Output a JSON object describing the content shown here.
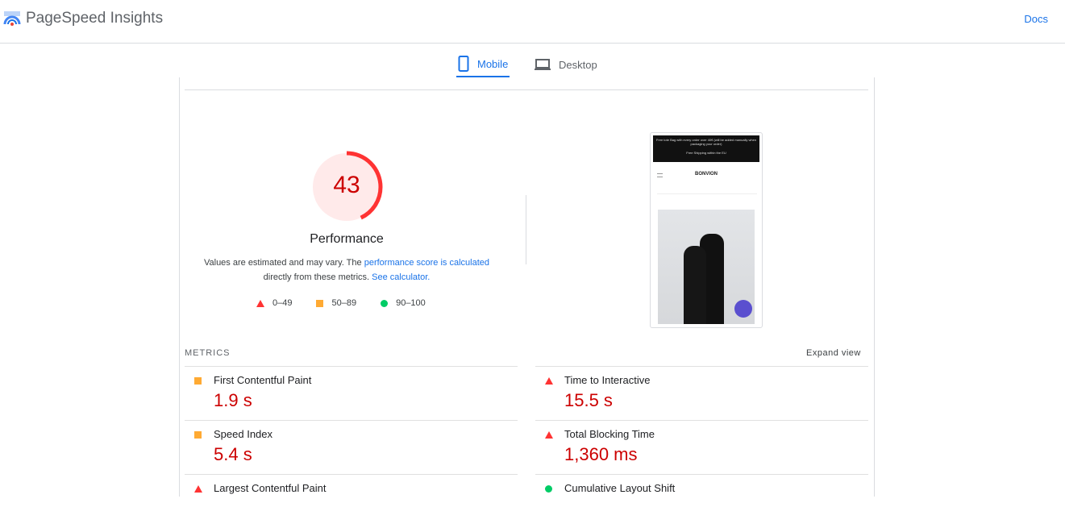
{
  "header": {
    "title": "PageSpeed Insights",
    "docs": "Docs"
  },
  "tabs": [
    {
      "label": "Mobile",
      "active": true
    },
    {
      "label": "Desktop",
      "active": false
    }
  ],
  "score": {
    "value": "43",
    "fraction": 0.43,
    "label": "Performance",
    "color": "#ff3333"
  },
  "description": {
    "text1": "Values are estimated and may vary. The ",
    "link1": "performance score is calculated",
    "text2": "directly from these metrics. ",
    "link2": "See calculator."
  },
  "legend": [
    {
      "range": "0–49",
      "shape": "triangle"
    },
    {
      "range": "50–89",
      "shape": "square"
    },
    {
      "range": "90–100",
      "shape": "circle"
    }
  ],
  "screenshot": {
    "banner1": "Free tote Bag with every order over 40€ (will be added manually when packaging your order)",
    "banner2": "Free Shipping within the EU",
    "brand": "BONVION"
  },
  "metrics": {
    "label": "METRICS",
    "expand": "Expand view",
    "items": [
      {
        "name": "First Contentful Paint",
        "value": "1.9 s",
        "rating": "square"
      },
      {
        "name": "Time to Interactive",
        "value": "15.5 s",
        "rating": "triangle"
      },
      {
        "name": "Speed Index",
        "value": "5.4 s",
        "rating": "square"
      },
      {
        "name": "Total Blocking Time",
        "value": "1,360 ms",
        "rating": "triangle"
      },
      {
        "name": "Largest Contentful Paint",
        "value": "",
        "rating": "triangle"
      },
      {
        "name": "Cumulative Layout Shift",
        "value": "",
        "rating": "circle"
      }
    ]
  }
}
